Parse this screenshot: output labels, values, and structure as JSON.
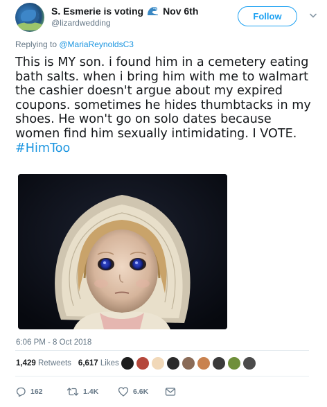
{
  "tweet": {
    "author": {
      "display_name": "S. Esmerie is voting",
      "name_suffix": "Nov 6th",
      "handle": "@lizardwedding",
      "avatar_icon": "gecko-avatar"
    },
    "follow_label": "Follow",
    "replying_prefix": "Replying to ",
    "replying_to": "@MariaReynoldsC3",
    "text_body": "This is MY son. i found him in a cemetery eating bath salts. when i bring him with me to walmart the cashier doesn't argue about my expired coupons. sometimes he hides thumbtacks in my shoes. He won't go on solo dates because women find him sexually intimidating. I VOTE. ",
    "hashtag": "#HimToo",
    "media_description_icon": "doll-photo",
    "timestamp": "6:06 PM - 8 Oct 2018",
    "stats": {
      "retweets_count": "1,429",
      "retweets_label": "Retweets",
      "likes_count": "6,617",
      "likes_label": "Likes"
    },
    "likers": [
      "#1d1d1d",
      "#b5473b",
      "#f1d8b8",
      "#2a2a2a",
      "#8a6b57",
      "#c9824f",
      "#3a3a3a",
      "#6f8f3a",
      "#4b4b4b"
    ],
    "actions": {
      "replies": "162",
      "retweets": "1.4K",
      "likes": "6.6K"
    },
    "colors": {
      "accent": "#1da1f2",
      "link": "#1b95e0",
      "muted": "#657786",
      "divider": "#e6ecf0"
    }
  }
}
